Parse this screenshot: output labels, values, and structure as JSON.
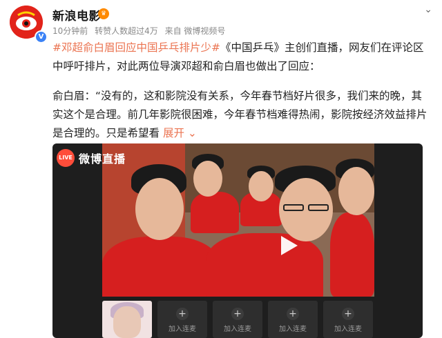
{
  "account": {
    "name": "新浪电影",
    "verified_mark": "V",
    "vip_mark": "♛"
  },
  "meta": {
    "time": "10分钟前",
    "reposts": "转赞人数超过4万",
    "source": "来自 微博视频号"
  },
  "post": {
    "hashtag": "#邓超俞白眉回应中国乒乓排片少#",
    "text": "《中国乒乓》主创们直播，网友们在评论区中呼吁排片，对此两位导演邓超和俞白眉也做出了回应：",
    "quote": "俞白眉：“没有的，这和影院没有关系，今年春节档好片很多，我们来的晚，其实这个是合理。前几年影院很困难，今年春节档难得热闹，影院按经济效益排片是合理的。只是希望看",
    "expand_label": "展开",
    "expand_icon": "chevron-down"
  },
  "video": {
    "live_logo_text": "LIVE",
    "live_title": "微博直播",
    "seat_label": "加入连麦",
    "seats": [
      {
        "label": "加入连麦"
      },
      {
        "label": "加入连麦"
      },
      {
        "label": "加入连麦"
      },
      {
        "label": "加入连麦"
      },
      {
        "label": "加入连麦"
      }
    ]
  },
  "colors": {
    "accent": "#eb7350",
    "brand_red": "#e2231a",
    "verified_blue": "#3b82f6"
  }
}
